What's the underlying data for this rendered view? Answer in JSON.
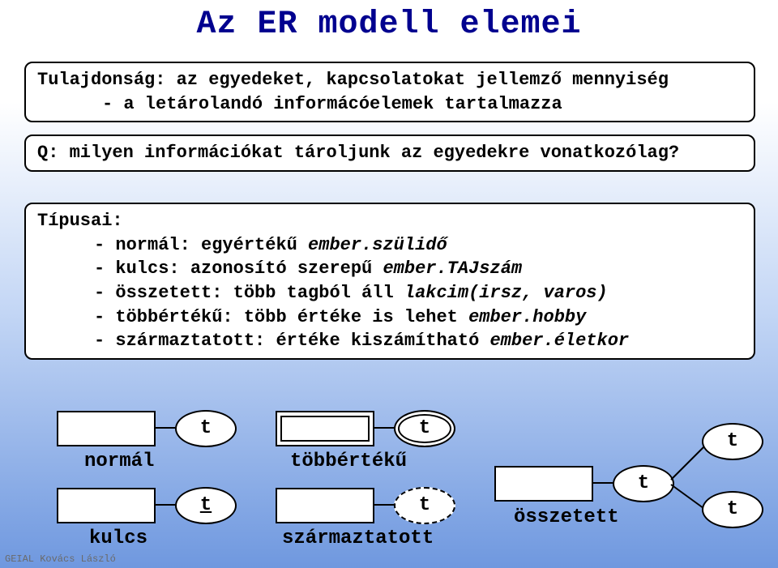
{
  "title": "Az ER modell elemei",
  "box_property": {
    "line1": "Tulajdonság: az egyedeket, kapcsolatokat jellemző mennyiség",
    "line2": "- a letárolandó informácóelemek tartalmazza"
  },
  "box_question": "Q: milyen információkat tároljunk az egyedekre vonatkozólag?",
  "types": {
    "heading": "Típusai:",
    "items": [
      {
        "text": "normál: egyértékű ",
        "example": "ember.szülidő"
      },
      {
        "text": "kulcs: azonosító szerepű",
        "example": "ember.TAJszám"
      },
      {
        "text": "összetett: több tagból áll ",
        "example": "lakcim(irsz, varos)"
      },
      {
        "text": "többértékű: több értéke is lehet ",
        "example": "ember.hobby"
      },
      {
        "text": "származtatott: értéke kiszámítható ",
        "example": "ember.életkor"
      }
    ]
  },
  "diagram": {
    "normal_label": "normál",
    "key_label": "kulcs",
    "multi_label": "többértékű",
    "derived_label": "származtatott",
    "composite_label": "összetett",
    "t": "t"
  },
  "author": "GEIAL Kovács László"
}
